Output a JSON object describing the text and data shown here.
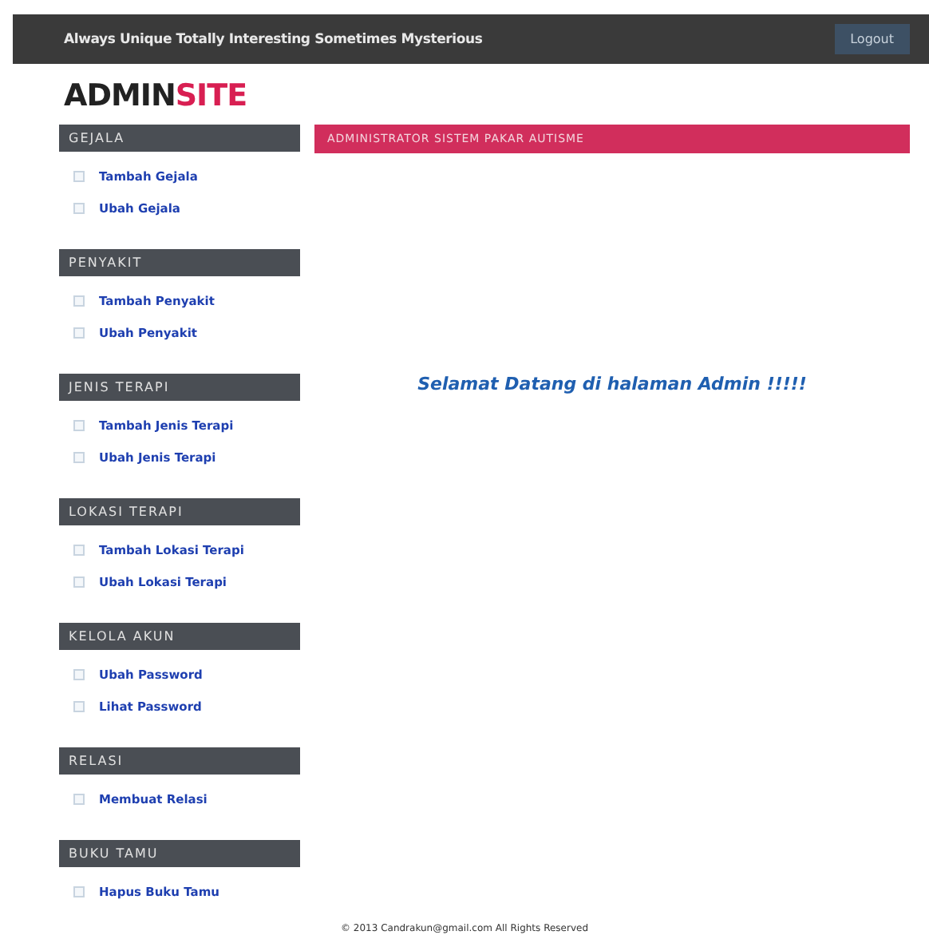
{
  "topbar": {
    "tagline": "Always Unique Totally Interesting Sometimes Mysterious",
    "logout": "Logout"
  },
  "logo": {
    "first": "ADMIN",
    "second": "SITE"
  },
  "sidebar": [
    {
      "title": "GEJALA",
      "items": [
        "Tambah Gejala",
        "Ubah Gejala"
      ]
    },
    {
      "title": "PENYAKIT",
      "items": [
        "Tambah Penyakit",
        "Ubah Penyakit"
      ]
    },
    {
      "title": "JENIS TERAPI",
      "items": [
        "Tambah Jenis Terapi",
        "Ubah Jenis Terapi"
      ]
    },
    {
      "title": "LOKASI TERAPI",
      "items": [
        "Tambah Lokasi Terapi",
        "Ubah Lokasi Terapi"
      ]
    },
    {
      "title": "KELOLA AKUN",
      "items": [
        "Ubah Password",
        "Lihat Password"
      ]
    },
    {
      "title": "RELASI",
      "items": [
        "Membuat Relasi"
      ]
    },
    {
      "title": "BUKU TAMU",
      "items": [
        "Hapus Buku Tamu"
      ]
    }
  ],
  "banner": "ADMINISTRATOR SISTEM PAKAR AUTISME",
  "welcome": "Selamat Datang di halaman Admin !!!!!",
  "footer": "© 2013 Candrakun@gmail.com All Rights Reserved"
}
